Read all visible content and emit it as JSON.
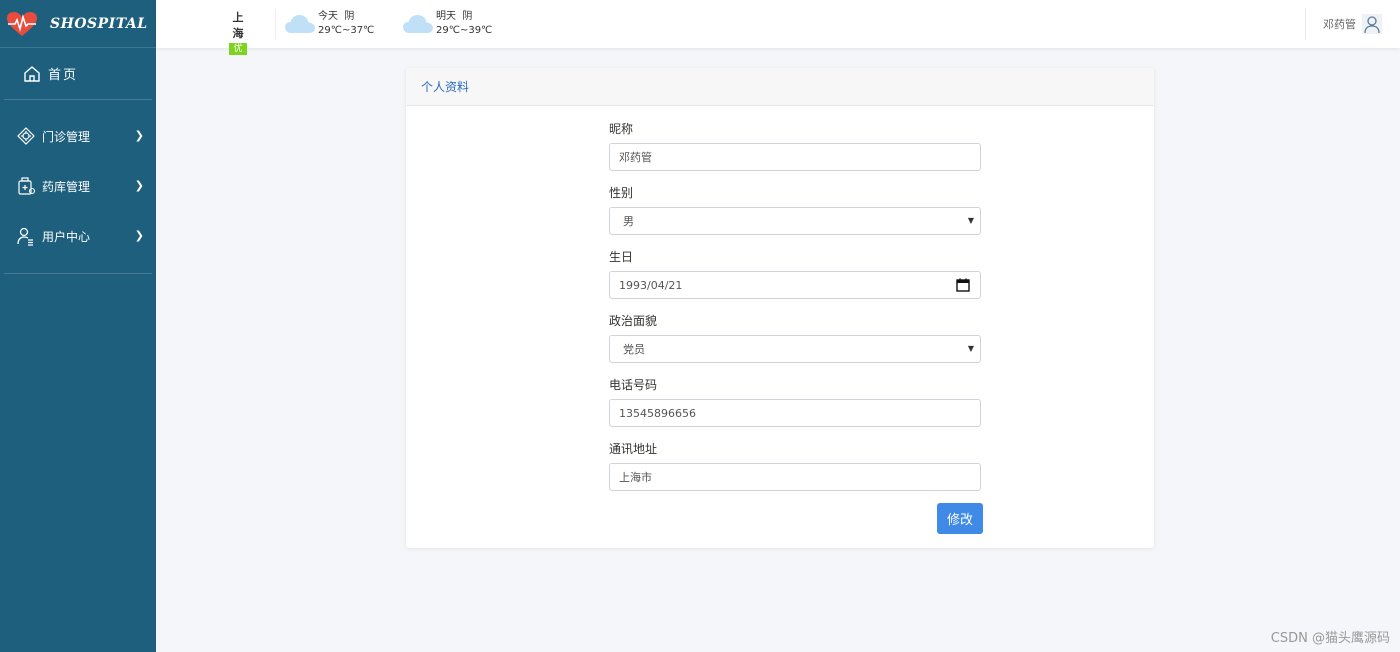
{
  "brand": {
    "name": "SHOSPITAL",
    "logo_icon": "heart-pulse-icon",
    "logo_color": "#e84c3d"
  },
  "sidebar": {
    "bg_color": "#1d5f7d",
    "home": {
      "label": "首页",
      "icon": "home-icon"
    },
    "items": [
      {
        "label": "门诊管理",
        "icon": "clinic-icon"
      },
      {
        "label": "药库管理",
        "icon": "pharmacy-icon"
      },
      {
        "label": "用户中心",
        "icon": "user-center-icon"
      }
    ]
  },
  "topbar": {
    "city": "上海",
    "aqi": "优",
    "aqi_color": "#7ed321",
    "weather": [
      {
        "day": "今天",
        "condition": "阴",
        "temp": "29℃~37℃"
      },
      {
        "day": "明天",
        "condition": "阴",
        "temp": "29℃~39℃"
      }
    ],
    "user_name": "邓药管"
  },
  "card": {
    "title": "个人资料",
    "title_color": "#2a6bbd",
    "fields": {
      "nickname": {
        "label": "昵称",
        "value": "邓药管"
      },
      "gender": {
        "label": "性别",
        "value": "男"
      },
      "birthday": {
        "label": "生日",
        "value": "1993/04/21"
      },
      "politics": {
        "label": "政治面貌",
        "value": "党员"
      },
      "phone": {
        "label": "电话号码",
        "value": "13545896656"
      },
      "address": {
        "label": "通讯地址",
        "value": "上海市"
      }
    },
    "submit_label": "修改",
    "submit_color": "#3e8ae6"
  },
  "watermark": "CSDN @猫头鹰源码"
}
